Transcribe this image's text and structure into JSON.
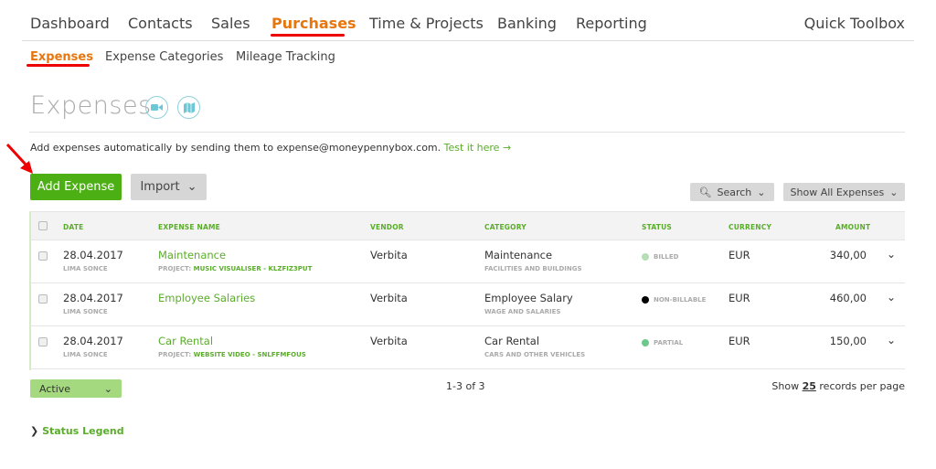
{
  "nav": {
    "items": [
      "Dashboard",
      "Contacts",
      "Sales",
      "Purchases",
      "Time & Projects",
      "Banking",
      "Reporting"
    ],
    "quick_toolbox": "Quick Toolbox"
  },
  "subnav": {
    "items": [
      "Expenses",
      "Expense Categories",
      "Mileage Tracking"
    ]
  },
  "page": {
    "title": "Expenses",
    "info": "Add expenses automatically by sending them to expense@moneypennybox.com.",
    "test_link": "Test it here →"
  },
  "toolbar": {
    "add": "Add Expense",
    "import": "Import",
    "search": "Search",
    "filter": "Show All Expenses"
  },
  "table": {
    "headers": [
      "DATE",
      "EXPENSE NAME",
      "VENDOR",
      "CATEGORY",
      "STATUS",
      "CURRENCY",
      "AMOUNT"
    ],
    "rows": [
      {
        "date": "28.04.2017",
        "user": "LIMA SONCE",
        "name": "Maintenance",
        "project_label": "PROJECT:",
        "project": "MUSIC VISUALISER - KLZFIZ3PUT",
        "vendor": "Verbita",
        "category": "Maintenance",
        "subcategory": "FACILITIES AND BUILDINGS",
        "status": "BILLED",
        "status_color": "#b5dfb5",
        "currency": "EUR",
        "amount": "340,00"
      },
      {
        "date": "28.04.2017",
        "user": "LIMA SONCE",
        "name": "Employee Salaries",
        "project_label": "",
        "project": "",
        "vendor": "Verbita",
        "category": "Employee Salary",
        "subcategory": "WAGE AND SALARIES",
        "status": "NON-BILLABLE",
        "status_color": "#000000",
        "currency": "EUR",
        "amount": "460,00"
      },
      {
        "date": "28.04.2017",
        "user": "LIMA SONCE",
        "name": "Car Rental",
        "project_label": "PROJECT:",
        "project": "WEBSITE VIDEO - SNLFFMFOUS",
        "vendor": "Verbita",
        "category": "Car Rental",
        "subcategory": "CARS AND OTHER VEHICLES",
        "status": "PARTIAL",
        "status_color": "#6cc98a",
        "currency": "EUR",
        "amount": "150,00"
      }
    ]
  },
  "footer": {
    "active": "Active",
    "pager": "1-3 of 3",
    "show": "Show",
    "per_page": "25",
    "records": "records per page",
    "legend": "Status Legend"
  }
}
